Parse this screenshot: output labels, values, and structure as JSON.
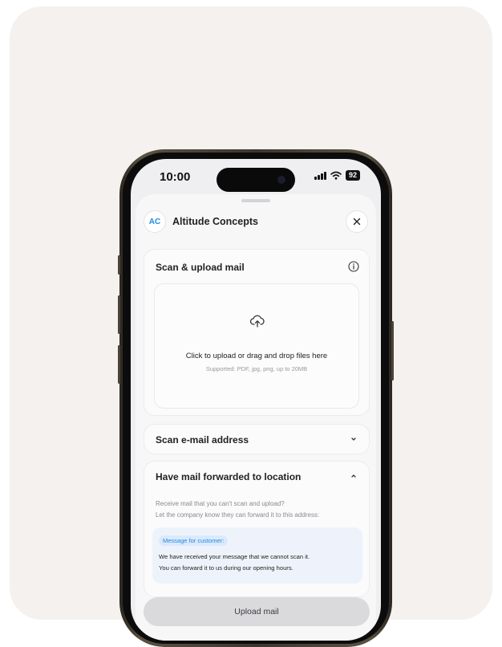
{
  "status_bar": {
    "time": "10:00",
    "battery": "92"
  },
  "header": {
    "avatar_initials": "AC",
    "company_name": "Altitude Concepts"
  },
  "scan_upload": {
    "title": "Scan & upload mail",
    "dropzone_text": "Click to upload or drag and drop files here",
    "dropzone_subtext": "Supported: PDF, jpg, png, up to 20MB"
  },
  "scan_email": {
    "title": "Scan e-mail address"
  },
  "forward": {
    "title": "Have mail forwarded to location",
    "description_line1": "Receive mail that you can't scan and upload?",
    "description_line2": "Let the company know they can forward it to this address:",
    "message_label": "Message for customer:",
    "message_line1": "We have received your message that we cannot scan it.",
    "message_line2": "You can forward it to us during our opening hours."
  },
  "footer": {
    "upload_label": "Upload mail"
  },
  "colors": {
    "accent": "#1d8ce0",
    "background": "#f4f1ee",
    "button": "#dadadd"
  }
}
